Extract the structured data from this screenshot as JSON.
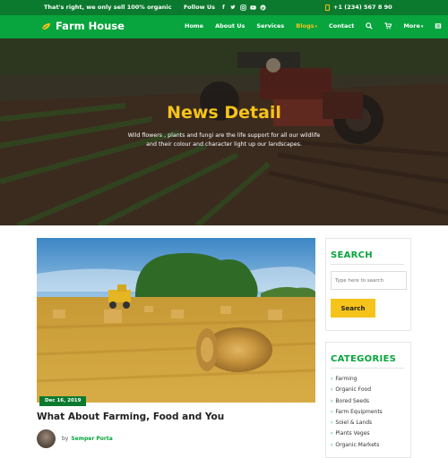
{
  "topbar": {
    "tagline": "That's right, we only sell 100% organic",
    "follow_label": "Follow Us",
    "social_icons": [
      "facebook-icon",
      "twitter-icon",
      "instagram-icon",
      "youtube-icon",
      "pinterest-icon"
    ],
    "phone": "+1 (234) 567 8 90"
  },
  "brand": {
    "name": "Farm House"
  },
  "nav": {
    "items": [
      "Home",
      "About Us",
      "Services",
      "Blogs",
      "Contact",
      "More"
    ],
    "active": "Blogs"
  },
  "hero": {
    "title": "News Detail",
    "subtitle_line1": "Wild flowers , plants and fungi are the life support for all our wildlife",
    "subtitle_line2": "and their colour and character light up our landscapes."
  },
  "article": {
    "date": "Dec 16, 2019",
    "title": "What About Farming, Food and You",
    "by": "by",
    "author": "Semper Porta"
  },
  "search": {
    "heading": "SEARCH",
    "placeholder": "Type here to search",
    "button": "Search"
  },
  "categories": {
    "heading": "CATEGORIES",
    "items": [
      "Farming",
      "Organic Food",
      "Bored Seeds",
      "Farm Equipments",
      "Soiel & Lands",
      "Plants Veges",
      "Organic Markets"
    ]
  },
  "colors": {
    "topbar": "#0b7a2e",
    "nav": "#08a43d",
    "accent_yellow": "#f6c31a",
    "heading_green": "#08a43d"
  }
}
